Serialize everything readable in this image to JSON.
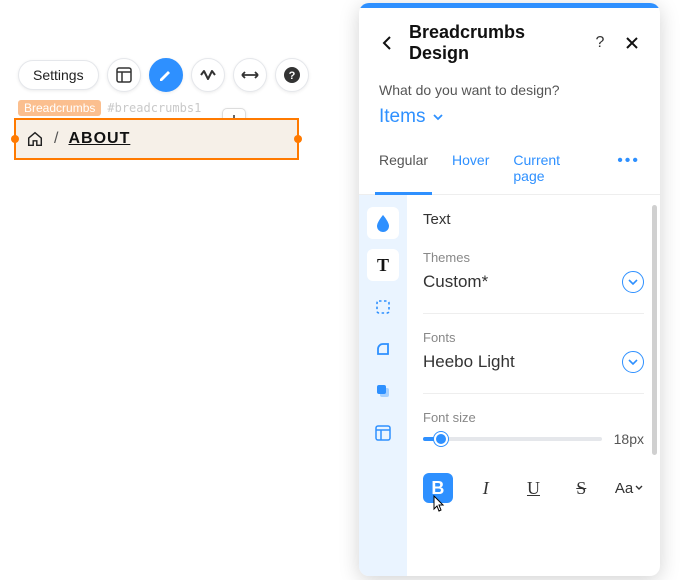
{
  "toolbar": {
    "settings_label": "Settings"
  },
  "tags": {
    "name": "Breadcrumbs",
    "id": "#breadcrumbs1"
  },
  "breadcrumb_preview": {
    "current": "ABOUT",
    "separator": "/"
  },
  "panel": {
    "title": "Breadcrumbs Design",
    "question": "What do you want to design?",
    "target": "Items",
    "tabs": {
      "regular": "Regular",
      "hover": "Hover",
      "current": "Current page"
    },
    "text": {
      "title": "Text",
      "themes_label": "Themes",
      "themes_value": "Custom*",
      "fonts_label": "Fonts",
      "fonts_value": "Heebo Light",
      "fontsize_label": "Font size",
      "fontsize_value": "18px",
      "style": {
        "bold": "B",
        "italic": "I",
        "underline": "U",
        "strike": "S",
        "case": "Aa"
      }
    }
  }
}
